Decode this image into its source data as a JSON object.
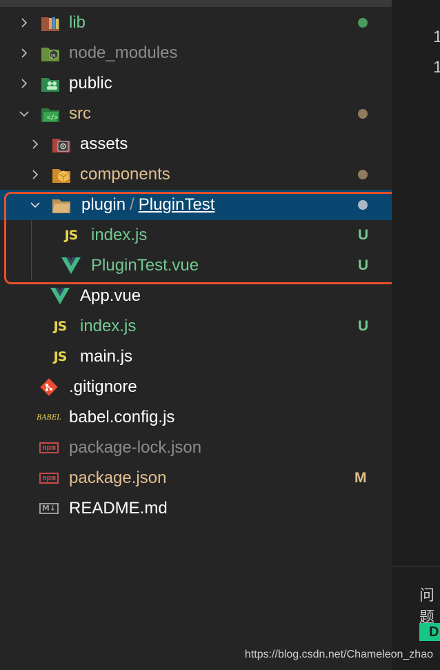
{
  "explorer": {
    "items": [
      {
        "label": "lib",
        "icon": "folder-lib-icon",
        "expanded": false,
        "status": "dot",
        "status_color": "#4a9a5c",
        "label_color": "green"
      },
      {
        "label": "node_modules",
        "icon": "folder-node-icon",
        "expanded": false,
        "status": "",
        "label_color": "dim"
      },
      {
        "label": "public",
        "icon": "folder-public-icon",
        "expanded": false,
        "status": "",
        "label_color": "white"
      },
      {
        "label": "src",
        "icon": "folder-src-icon",
        "expanded": true,
        "status": "dot",
        "status_color": "#8f7b5f",
        "label_color": "yellow"
      },
      {
        "label": "assets",
        "icon": "folder-assets-icon",
        "expanded": false,
        "status": "",
        "label_color": "white"
      },
      {
        "label": "components",
        "icon": "folder-components-icon",
        "expanded": false,
        "status": "dot",
        "status_color": "#8f7b5f",
        "label_color": "yellow"
      },
      {
        "label": "plugin",
        "label_sep": "/",
        "label_child": "PluginTest",
        "icon": "folder-open-icon",
        "expanded": true,
        "selected": true,
        "status": "dot",
        "status_color": "#a9b8c9",
        "label_color": "white"
      },
      {
        "label": "index.js",
        "icon": "javascript-icon",
        "status": "U",
        "label_color": "green"
      },
      {
        "label": "PluginTest.vue",
        "icon": "vue-icon",
        "status": "U",
        "label_color": "green"
      },
      {
        "label": "App.vue",
        "icon": "vue-icon",
        "status": "",
        "label_color": "white"
      },
      {
        "label": "index.js",
        "icon": "javascript-icon",
        "status": "U",
        "label_color": "green"
      },
      {
        "label": "main.js",
        "icon": "javascript-icon",
        "status": "",
        "label_color": "white"
      },
      {
        "label": ".gitignore",
        "icon": "git-icon",
        "status": "",
        "label_color": "white"
      },
      {
        "label": "babel.config.js",
        "icon": "babel-icon",
        "status": "",
        "label_color": "white"
      },
      {
        "label": "package-lock.json",
        "icon": "npm-icon",
        "status": "",
        "label_color": "dim"
      },
      {
        "label": "package.json",
        "icon": "npm-icon",
        "status": "M",
        "label_color": "yellow"
      },
      {
        "label": "README.md",
        "icon": "markdown-icon",
        "status": "",
        "label_color": "white"
      }
    ],
    "js_icon_text": "JS",
    "babel_icon_text": "BABEL",
    "npm_icon_text": "npm",
    "md_icon_text": "M↓"
  },
  "editor": {
    "line_numbers": [
      "1",
      "1"
    ]
  },
  "panel": {
    "tab_label": "问题",
    "button_label": "D"
  },
  "watermark": "https://blog.csdn.net/Chameleon_zhao",
  "colors": {
    "accent_selected": "#094771",
    "untracked_green": "#73c991",
    "modified_yellow": "#e2c08d",
    "highlight_box": "#e8502a"
  }
}
